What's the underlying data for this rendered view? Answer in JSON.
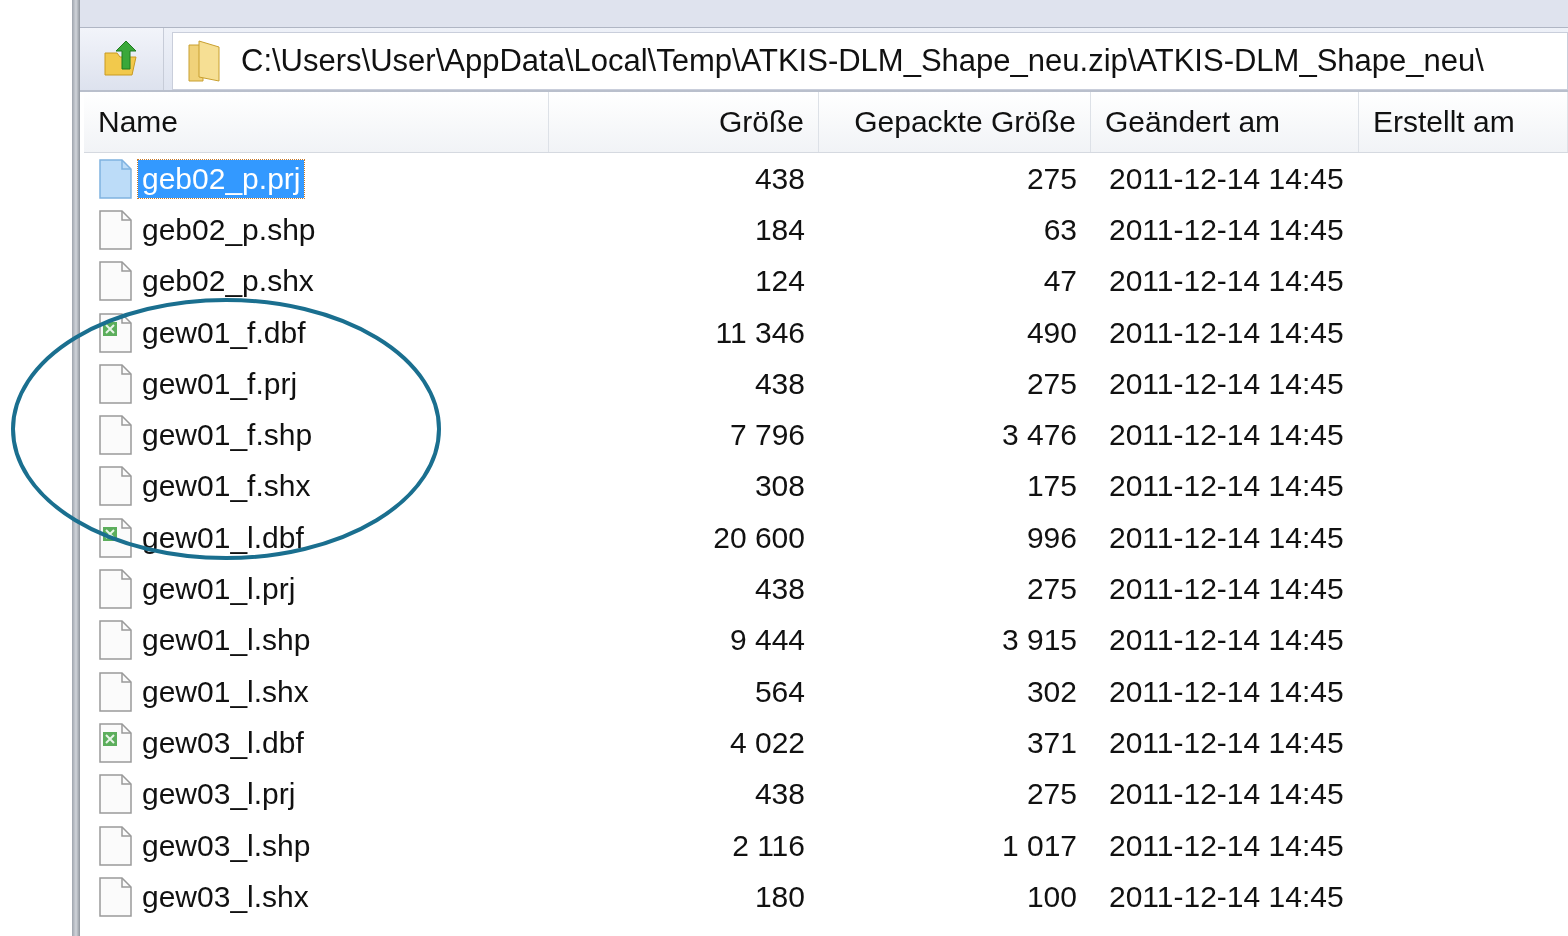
{
  "address_bar": {
    "path": "C:\\Users\\User\\AppData\\Local\\Temp\\ATKIS-DLM_Shape_neu.zip\\ATKIS-DLM_Shape_neu\\"
  },
  "table": {
    "columns": [
      "Name",
      "Größe",
      "Gepackte Größe",
      "Geändert am",
      "Erstellt am"
    ],
    "rows": [
      {
        "kind": "file",
        "selected": true,
        "name": "geb02_p.prj",
        "size": "438",
        "packed": "275",
        "modified": "2011-12-14 14:45"
      },
      {
        "kind": "file",
        "selected": false,
        "name": "geb02_p.shp",
        "size": "184",
        "packed": "63",
        "modified": "2011-12-14 14:45"
      },
      {
        "kind": "file",
        "selected": false,
        "name": "geb02_p.shx",
        "size": "124",
        "packed": "47",
        "modified": "2011-12-14 14:45"
      },
      {
        "kind": "spreadsheet",
        "selected": false,
        "name": "gew01_f.dbf",
        "size": "11 346",
        "packed": "490",
        "modified": "2011-12-14 14:45"
      },
      {
        "kind": "file",
        "selected": false,
        "name": "gew01_f.prj",
        "size": "438",
        "packed": "275",
        "modified": "2011-12-14 14:45"
      },
      {
        "kind": "file",
        "selected": false,
        "name": "gew01_f.shp",
        "size": "7 796",
        "packed": "3 476",
        "modified": "2011-12-14 14:45"
      },
      {
        "kind": "file",
        "selected": false,
        "name": "gew01_f.shx",
        "size": "308",
        "packed": "175",
        "modified": "2011-12-14 14:45"
      },
      {
        "kind": "spreadsheet",
        "selected": false,
        "name": "gew01_l.dbf",
        "size": "20 600",
        "packed": "996",
        "modified": "2011-12-14 14:45"
      },
      {
        "kind": "file",
        "selected": false,
        "name": "gew01_l.prj",
        "size": "438",
        "packed": "275",
        "modified": "2011-12-14 14:45"
      },
      {
        "kind": "file",
        "selected": false,
        "name": "gew01_l.shp",
        "size": "9 444",
        "packed": "3 915",
        "modified": "2011-12-14 14:45"
      },
      {
        "kind": "file",
        "selected": false,
        "name": "gew01_l.shx",
        "size": "564",
        "packed": "302",
        "modified": "2011-12-14 14:45"
      },
      {
        "kind": "spreadsheet",
        "selected": false,
        "name": "gew03_l.dbf",
        "size": "4 022",
        "packed": "371",
        "modified": "2011-12-14 14:45"
      },
      {
        "kind": "file",
        "selected": false,
        "name": "gew03_l.prj",
        "size": "438",
        "packed": "275",
        "modified": "2011-12-14 14:45"
      },
      {
        "kind": "file",
        "selected": false,
        "name": "gew03_l.shp",
        "size": "2 116",
        "packed": "1 017",
        "modified": "2011-12-14 14:45"
      },
      {
        "kind": "file",
        "selected": false,
        "name": "gew03_l.shx",
        "size": "180",
        "packed": "100",
        "modified": "2011-12-14 14:45"
      }
    ]
  },
  "annotation": {
    "kind": "ellipse"
  }
}
